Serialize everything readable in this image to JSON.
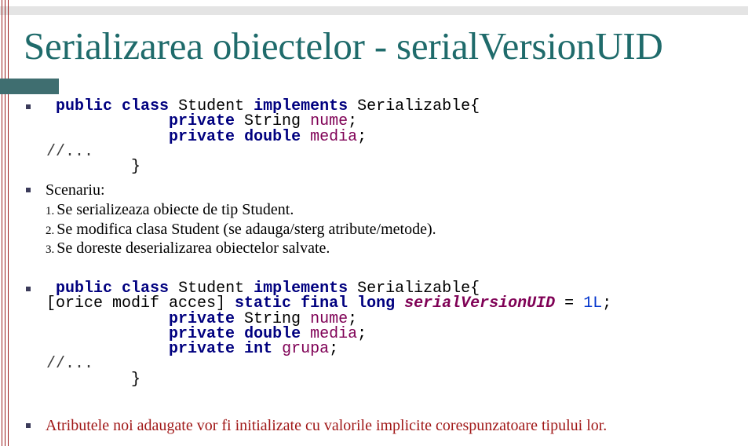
{
  "title": "Serializarea obiectelor - serialVersionUID",
  "code1": {
    "l1": [
      "public",
      "class",
      " Student ",
      "implements",
      " Serializable{"
    ],
    "l2": [
      "private",
      " String ",
      "nume",
      ";"
    ],
    "l3": [
      "private",
      "double",
      "media",
      ";"
    ],
    "comment": "//...",
    "close": "}"
  },
  "scenario": {
    "heading": "Scenariu:",
    "steps": [
      {
        "num": "1.",
        "text": "Se serializeaza obiecte de tip Student."
      },
      {
        "num": "2.",
        "text": "Se modifica clasa Student (se adauga/sterg atribute/metode)."
      },
      {
        "num": "3.",
        "text": "Se doreste deserializarea obiectelor salvate."
      }
    ]
  },
  "code2": {
    "l1": [
      "public",
      "class",
      " Student ",
      "implements",
      " Serializable{"
    ],
    "l2": [
      "[orice modif acces] ",
      "static",
      "final",
      "long",
      "serialVersionUID",
      " = ",
      "1L",
      ";"
    ],
    "l3": [
      "private",
      " String ",
      "nume",
      ";"
    ],
    "l4": [
      "private",
      "double",
      "media",
      ";"
    ],
    "l5": [
      "private",
      "int",
      "grupa",
      ";"
    ],
    "comment": "//...",
    "close": "}"
  },
  "note": "Atributele noi adaugate vor fi initializate cu valorile implicite corespunzatoare tipului lor."
}
